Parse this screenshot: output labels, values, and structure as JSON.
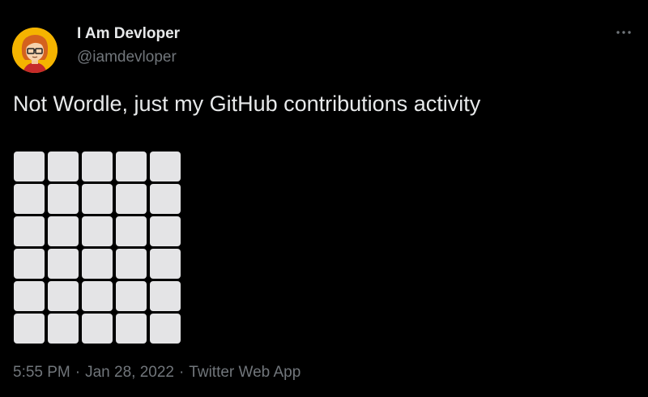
{
  "colors": {
    "background": "#000000",
    "primary_text": "#e7e9ea",
    "secondary_text": "#71767b",
    "tile": "#e4e4e6",
    "avatar_bg": "#f5b400"
  },
  "author": {
    "display_name": "I Am Devloper",
    "handle": "@iamdevloper",
    "avatar_icon": "cartoon-developer-avatar"
  },
  "menu": {
    "icon": "more-horizontal-icon"
  },
  "tweet": {
    "text": "Not Wordle, just my GitHub contributions activity"
  },
  "contribution_grid": {
    "rows": 6,
    "columns": 5,
    "filled_cells": 0
  },
  "meta": {
    "time": "5:55 PM",
    "date": "Jan 28, 2022",
    "separator": "·",
    "source": "Twitter Web App"
  }
}
